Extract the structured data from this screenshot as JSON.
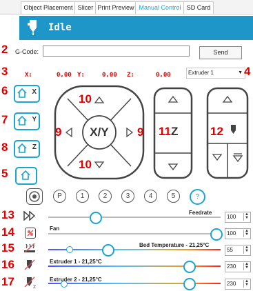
{
  "tabs": [
    {
      "label": "Object Placement"
    },
    {
      "label": "Slicer"
    },
    {
      "label": "Print Preview"
    },
    {
      "label": "Manual Control"
    },
    {
      "label": "SD Card"
    }
  ],
  "status": "Idle",
  "gcode": {
    "label": "G-Code:",
    "value": "",
    "send_label": "Send"
  },
  "coords": {
    "x_label": "X:",
    "x": "0,00",
    "y_label": "Y:",
    "y": "0,00",
    "z_label": "Z:",
    "z": "0,00"
  },
  "extruder_select": "Extruder 1",
  "home_labels": {
    "x": "X",
    "y": "Y",
    "z": "Z"
  },
  "pad": {
    "xy": "X/Y",
    "z": "Z"
  },
  "presets": [
    "P",
    "1",
    "2",
    "3",
    "4",
    "5",
    "?"
  ],
  "sliders": {
    "feedrate": {
      "label": "Feedrate",
      "value": "100",
      "level": 0.2
    },
    "fan": {
      "label": "Fan",
      "value": "100",
      "level": 1.0
    },
    "bed": {
      "label": "Bed Temperature - 21,25°C",
      "value": "55",
      "level": 0.35
    },
    "ext1": {
      "label": "Extruder 1 - 21,25°C",
      "value": "230",
      "level": 0.8
    },
    "ext2": {
      "label": "Extruder 2 - 21,25°C",
      "value": "230",
      "level": 0.8
    }
  },
  "callouts": [
    "1",
    "2",
    "3",
    "4",
    "5",
    "6",
    "7",
    "8",
    "9",
    "9",
    "10",
    "10",
    "11",
    "12",
    "13",
    "14",
    "15",
    "16",
    "17"
  ],
  "colors": {
    "accent": "#1aa5cf",
    "header": "#1e96c8",
    "callout": "#e00000"
  }
}
